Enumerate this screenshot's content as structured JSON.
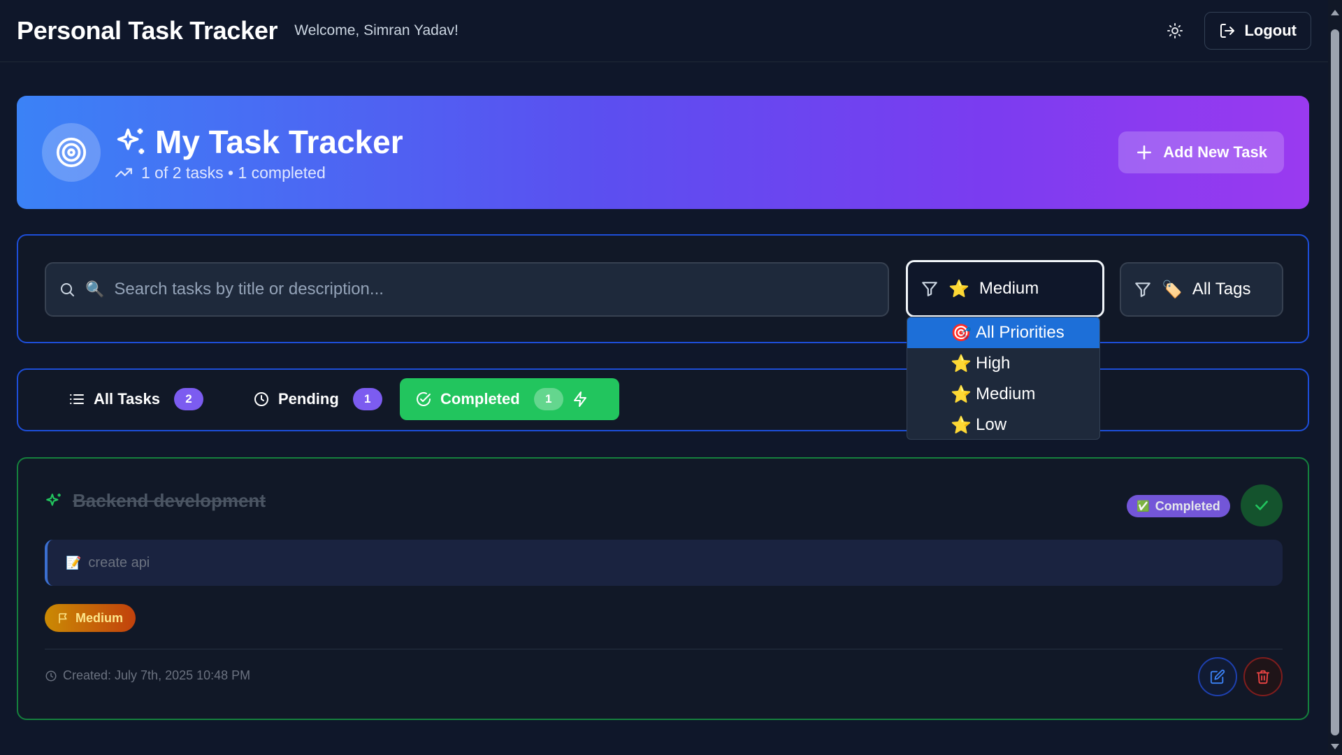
{
  "header": {
    "title": "Personal Task Tracker",
    "welcome": "Welcome, Simran Yadav!",
    "logout_label": "Logout",
    "theme_icon": "sun-icon"
  },
  "hero": {
    "title": "My Task Tracker",
    "subtitle": "1 of 2 tasks • 1 completed",
    "add_label": "Add New Task",
    "colors": {
      "start": "#3b82f6",
      "end": "#9a3af0"
    }
  },
  "filters": {
    "search_placeholder": "Search tasks by title or description...",
    "search_emoji": "🔍",
    "priority_selected": "Medium",
    "priority_emoji": "⭐",
    "tags_selected": "All Tags",
    "tags_emoji": "🏷️"
  },
  "priority_options": [
    {
      "emoji": "🎯",
      "label": "All Priorities",
      "selected": true
    },
    {
      "emoji": "⭐",
      "label": "High",
      "selected": false
    },
    {
      "emoji": "⭐",
      "label": "Medium",
      "selected": false
    },
    {
      "emoji": "⭐",
      "label": "Low",
      "selected": false
    }
  ],
  "tabs": [
    {
      "label": "All Tasks",
      "count": "2",
      "icon": "list-icon"
    },
    {
      "label": "Pending",
      "count": "1",
      "icon": "clock-icon"
    },
    {
      "label": "Completed",
      "count": "1",
      "icon": "check-circle-icon",
      "active": true
    }
  ],
  "task": {
    "title": "Backend development",
    "status": "Completed",
    "status_emoji": "✅",
    "description": "create api",
    "description_emoji": "📝",
    "priority": "Medium",
    "created": "Created: July 7th, 2025 10:48 PM"
  },
  "colors": {
    "background": "#0f172a",
    "accent_blue": "#1d4ed8",
    "success": "#22c55e",
    "badge_purple": "#7c5cf0"
  }
}
